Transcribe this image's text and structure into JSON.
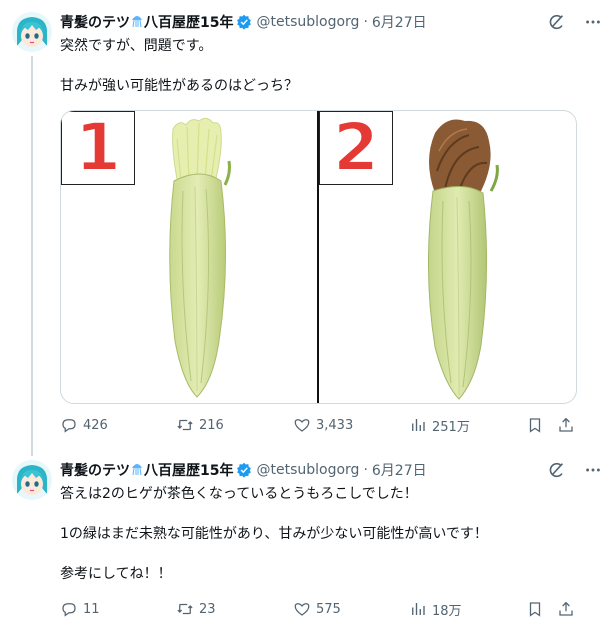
{
  "tweets": [
    {
      "author": {
        "name": "青髪のテツ",
        "name_suffix": "八百屋歴15年",
        "handle": "@tetsublogorg",
        "date": "6月27日",
        "verified": true
      },
      "text": [
        "突然ですが、問題です。",
        "",
        "甘みが強い可能性があるのはどっち？"
      ],
      "media": {
        "panel_labels": [
          "1",
          "2"
        ]
      },
      "stats": {
        "replies": "426",
        "reposts": "216",
        "likes": "3,433",
        "views": "251万"
      }
    },
    {
      "author": {
        "name": "青髪のテツ",
        "name_suffix": "八百屋歴15年",
        "handle": "@tetsublogorg",
        "date": "6月27日",
        "verified": true
      },
      "text": [
        "答えは2のヒゲが茶色くなっているとうもろこしでした！",
        "",
        "1の緑はまだ未熟な可能性があり、甘みが少ない可能性が高いです！",
        "",
        "参考にしてね！！"
      ],
      "stats": {
        "replies": "11",
        "reposts": "23",
        "likes": "575",
        "views": "18万"
      }
    }
  ],
  "colors": {
    "accent": "#1d9bf0",
    "muted": "#536471",
    "label_red": "#e53935",
    "border": "#cfd9de"
  },
  "icons": [
    "grok-icon",
    "more-icon",
    "reply-icon",
    "repost-icon",
    "like-icon",
    "views-icon",
    "bookmark-icon",
    "share-icon",
    "verified-badge-icon",
    "jellyfish-icon"
  ]
}
